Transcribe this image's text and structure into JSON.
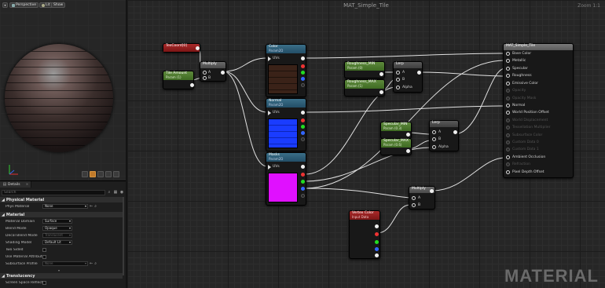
{
  "viewport": {
    "buttons": [
      "Perspective",
      "Lit",
      "Show"
    ]
  },
  "details": {
    "tab_label": "Details",
    "search_placeholder": "Search",
    "sections": {
      "physical_material": "Physical Material",
      "material": "Material",
      "translucency": "Translucency"
    },
    "properties": {
      "phys_material": {
        "label": "Phys Material",
        "value": "None"
      },
      "material_domain": {
        "label": "Material Domain",
        "value": "Surface"
      },
      "blend_mode": {
        "label": "Blend Mode",
        "value": "Opaque"
      },
      "decal_blend_mode": {
        "label": "Decal Blend Mode",
        "value": "Translucent"
      },
      "shading_model": {
        "label": "Shading Model",
        "value": "Default Lit"
      },
      "two_sided": {
        "label": "Two Sided"
      },
      "use_material_attributes": {
        "label": "Use Material Attributes"
      },
      "subsurface_profile": {
        "label": "Subsurface Profile",
        "value": "None"
      },
      "screen_space_reflections": {
        "label": "Screen Space Reflections"
      }
    }
  },
  "graph": {
    "title": "MAT_Simple_Tile",
    "zoom": "Zoom 1:1",
    "watermark": "MATERIAL",
    "nodes": {
      "texcoord": {
        "title": "TexCoord[0]"
      },
      "tile_amount": {
        "title": "Tile Amount",
        "subtitle": "Param (1)"
      },
      "multiply1": {
        "title": "Multiply"
      },
      "color": {
        "title": "Color",
        "subtitle": "Param2D",
        "input": "UVs"
      },
      "normal": {
        "title": "Normal",
        "subtitle": "Param2D",
        "input": "UVs"
      },
      "masks": {
        "title": "Masks",
        "subtitle": "Param2D",
        "input": "UVs"
      },
      "roughness_min": {
        "title": "Roughness_MIN",
        "subtitle": "Param (0)"
      },
      "roughness_max": {
        "title": "Roughness_MAX",
        "subtitle": "Param (1)"
      },
      "lerp1": {
        "title": "Lerp",
        "inputs": [
          "A",
          "B",
          "Alpha"
        ]
      },
      "specular_min": {
        "title": "Specular_MIN",
        "subtitle": "Param (0.3)"
      },
      "specular_max": {
        "title": "Specular_MAX",
        "subtitle": "Param (0.6)"
      },
      "lerp2": {
        "title": "Lerp",
        "inputs": [
          "A",
          "B",
          "Alpha"
        ]
      },
      "multiply2": {
        "title": "Multiply",
        "inputs": [
          "A",
          "B"
        ]
      },
      "vertex_color": {
        "title": "Vertex Color",
        "subtitle": "Input Data"
      },
      "result": {
        "title": "MAT_Simple_Tile",
        "inputs": [
          {
            "label": "Base Color",
            "enabled": true
          },
          {
            "label": "Metallic",
            "enabled": true
          },
          {
            "label": "Specular",
            "enabled": true
          },
          {
            "label": "Roughness",
            "enabled": true
          },
          {
            "label": "Emissive Color",
            "enabled": true
          },
          {
            "label": "Opacity",
            "enabled": false
          },
          {
            "label": "Opacity Mask",
            "enabled": false
          },
          {
            "label": "Normal",
            "enabled": true
          },
          {
            "label": "World Position Offset",
            "enabled": true
          },
          {
            "label": "World Displacement",
            "enabled": false
          },
          {
            "label": "Tessellation Multiplier",
            "enabled": false
          },
          {
            "label": "Subsurface Color",
            "enabled": false
          },
          {
            "label": "Custom Data 0",
            "enabled": false
          },
          {
            "label": "Custom Data 1",
            "enabled": false
          },
          {
            "label": "Ambient Occlusion",
            "enabled": true
          },
          {
            "label": "Refraction",
            "enabled": false
          },
          {
            "label": "Pixel Depth Offset",
            "enabled": true
          }
        ]
      }
    }
  }
}
